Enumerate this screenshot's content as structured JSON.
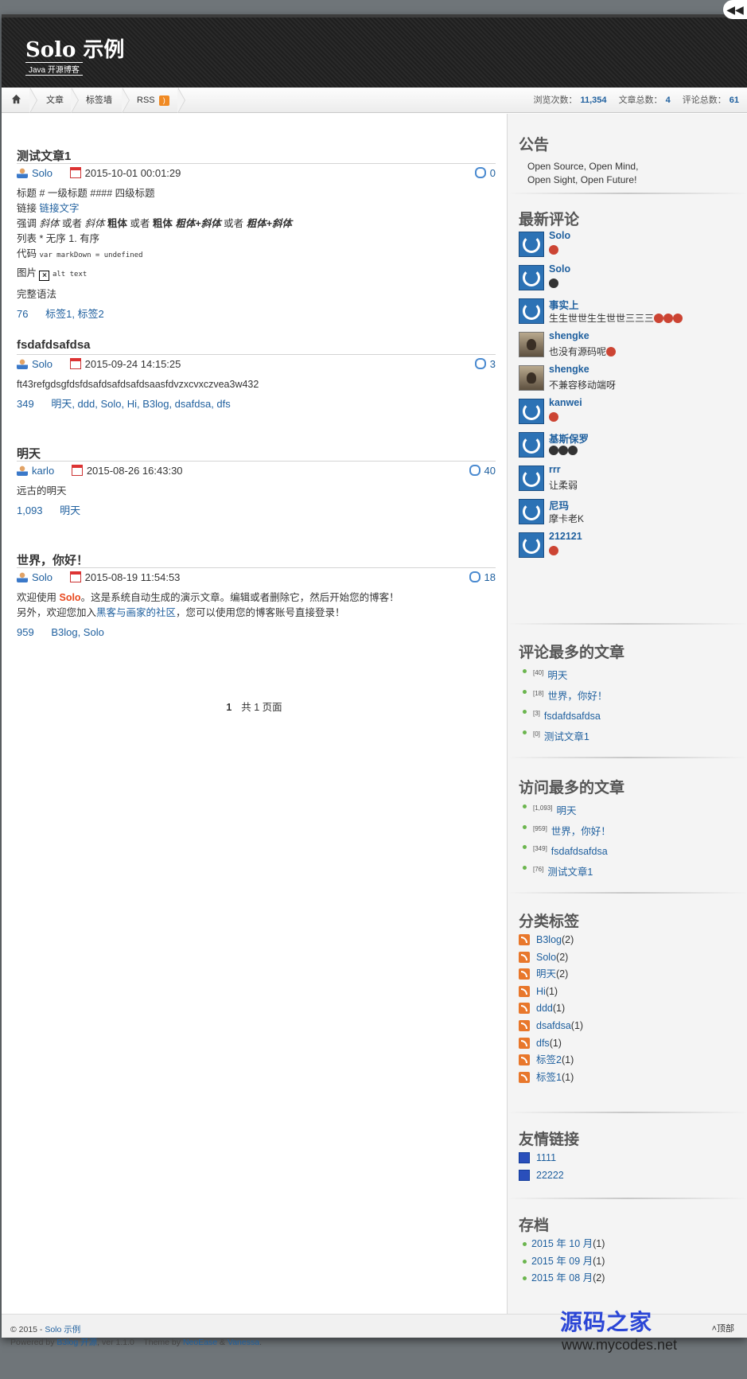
{
  "header": {
    "title": "Solo 示例",
    "subtitle": "Java 开源博客"
  },
  "nav": {
    "items": [
      "文章",
      "标签墙",
      "RSS"
    ],
    "stats": {
      "views_label": "浏览次数：",
      "views": "11,354",
      "articles_label": "文章总数：",
      "articles": "4",
      "comments_label": "评论总数：",
      "comments": "61"
    }
  },
  "articles": [
    {
      "title": "测试文章1",
      "author": "Solo",
      "date": "2015-10-01 00:01:29",
      "comments": "0",
      "lines": {
        "l1": "标题 # 一级标题 #### 四级标题",
        "l2_prefix": "链接 ",
        "l2_link": "链接文字",
        "l3_a": "强调 ",
        "l3_b": "斜体",
        "l3_c": " 或者 ",
        "l3_d": "斜体",
        "l3_e": " 粗体",
        "l3_f": " 或者 ",
        "l3_g": "粗体",
        "l3_h": " 粗体+斜体",
        "l3_i": " 或者 ",
        "l3_j": "粗体+斜体",
        "l4": "列表 * 无序 1. 有序",
        "l5_prefix": "代码 ",
        "l5_code": "var markDown = undefined",
        "l6_prefix": "图片 ",
        "l6_alt": "alt text",
        "l7": "完整语法"
      },
      "views": "76",
      "tags": "标签1, 标签2"
    },
    {
      "title": "fsdafdsafdsa",
      "author": "Solo",
      "date": "2015-09-24 14:15:25",
      "comments": "3",
      "body": "ft43refgdsgfdsfdsafdsafdsafdsaasfdvzxcvxczvea3w432",
      "views": "349",
      "tags": "明天, ddd, Solo, Hi, B3log, dsafdsa, dfs"
    },
    {
      "title": "明天",
      "author": "karlo",
      "date": "2015-08-26 16:43:30",
      "comments": "40",
      "body": "远古的明天",
      "views": "1,093",
      "tags": "明天"
    },
    {
      "title": "世界，你好！",
      "author": "Solo",
      "date": "2015-08-19 11:54:53",
      "comments": "18",
      "body_a": "欢迎使用 ",
      "body_b": "Solo",
      "body_c": "。这是系统自动生成的演示文章。编辑或者删除它，然后开始您的博客！",
      "body2_a": "另外，欢迎您加入",
      "body2_b": "黑客与画家的社区",
      "body2_c": "，您可以使用您的博客账号直接登录！",
      "views": "959",
      "tags": "B3log, Solo"
    }
  ],
  "pager": {
    "current": "1",
    "total_text": "共 1 页面"
  },
  "sidebar": {
    "notice": {
      "title": "公告",
      "lines": [
        "Open Source, Open Mind,",
        "Open Sight, Open Future!"
      ]
    },
    "recent_comments": {
      "title": "最新评论",
      "items": [
        {
          "name": "Solo",
          "text": ""
        },
        {
          "name": "Solo",
          "text": ""
        },
        {
          "name": "事实上",
          "text": "生生世世生生世世三三三"
        },
        {
          "name": "shengke",
          "text": "也没有源码呢"
        },
        {
          "name": "shengke",
          "text": "不兼容移动端呀"
        },
        {
          "name": "kanwei",
          "text": ""
        },
        {
          "name": "基斯保罗",
          "text": ""
        },
        {
          "name": "rrr",
          "text": "让柔弱"
        },
        {
          "name": "尼玛",
          "text": "摩卡老K"
        },
        {
          "name": "212121",
          "text": ""
        }
      ]
    },
    "most_commented": {
      "title": "评论最多的文章",
      "items": [
        {
          "count": "[40]",
          "title": "明天"
        },
        {
          "count": "[18]",
          "title": "世界，你好！"
        },
        {
          "count": "[3]",
          "title": "fsdafdsafdsa"
        },
        {
          "count": "[0]",
          "title": "测试文章1"
        }
      ]
    },
    "most_viewed": {
      "title": "访问最多的文章",
      "items": [
        {
          "count": "[1,093]",
          "title": "明天"
        },
        {
          "count": "[959]",
          "title": "世界，你好！"
        },
        {
          "count": "[349]",
          "title": "fsdafdsafdsa"
        },
        {
          "count": "[76]",
          "title": "测试文章1"
        }
      ]
    },
    "tags": {
      "title": "分类标签",
      "items": [
        {
          "name": "B3log",
          "count": "(2)"
        },
        {
          "name": "Solo",
          "count": "(2)"
        },
        {
          "name": "明天",
          "count": "(2)"
        },
        {
          "name": "Hi",
          "count": "(1)"
        },
        {
          "name": "ddd",
          "count": "(1)"
        },
        {
          "name": "dsafdsa",
          "count": "(1)"
        },
        {
          "name": "dfs",
          "count": "(1)"
        },
        {
          "name": "标签2",
          "count": "(1)"
        },
        {
          "name": "标签1",
          "count": "(1)"
        }
      ]
    },
    "links": {
      "title": "友情链接",
      "items": [
        "1111",
        "22222"
      ]
    },
    "archive": {
      "title": "存档",
      "items": [
        {
          "label": "2015 年 10 月",
          "count": "(1)"
        },
        {
          "label": "2015 年 09 月",
          "count": "(1)"
        },
        {
          "label": "2015 年 08 月",
          "count": "(2)"
        }
      ]
    }
  },
  "footer": {
    "copyright": "© 2015 - ",
    "site_link": "Solo 示例",
    "powered_by": "Powered by ",
    "b3log": "B3log 开源",
    "version": ", ver 1.1.0    Theme by ",
    "neoease": "NeoEase",
    "amp": " & ",
    "vanessa": "Vanessa",
    "dot": ".",
    "top": "顶部"
  },
  "watermark": {
    "name": "源码之家",
    "url": "www.mycodes.net"
  }
}
